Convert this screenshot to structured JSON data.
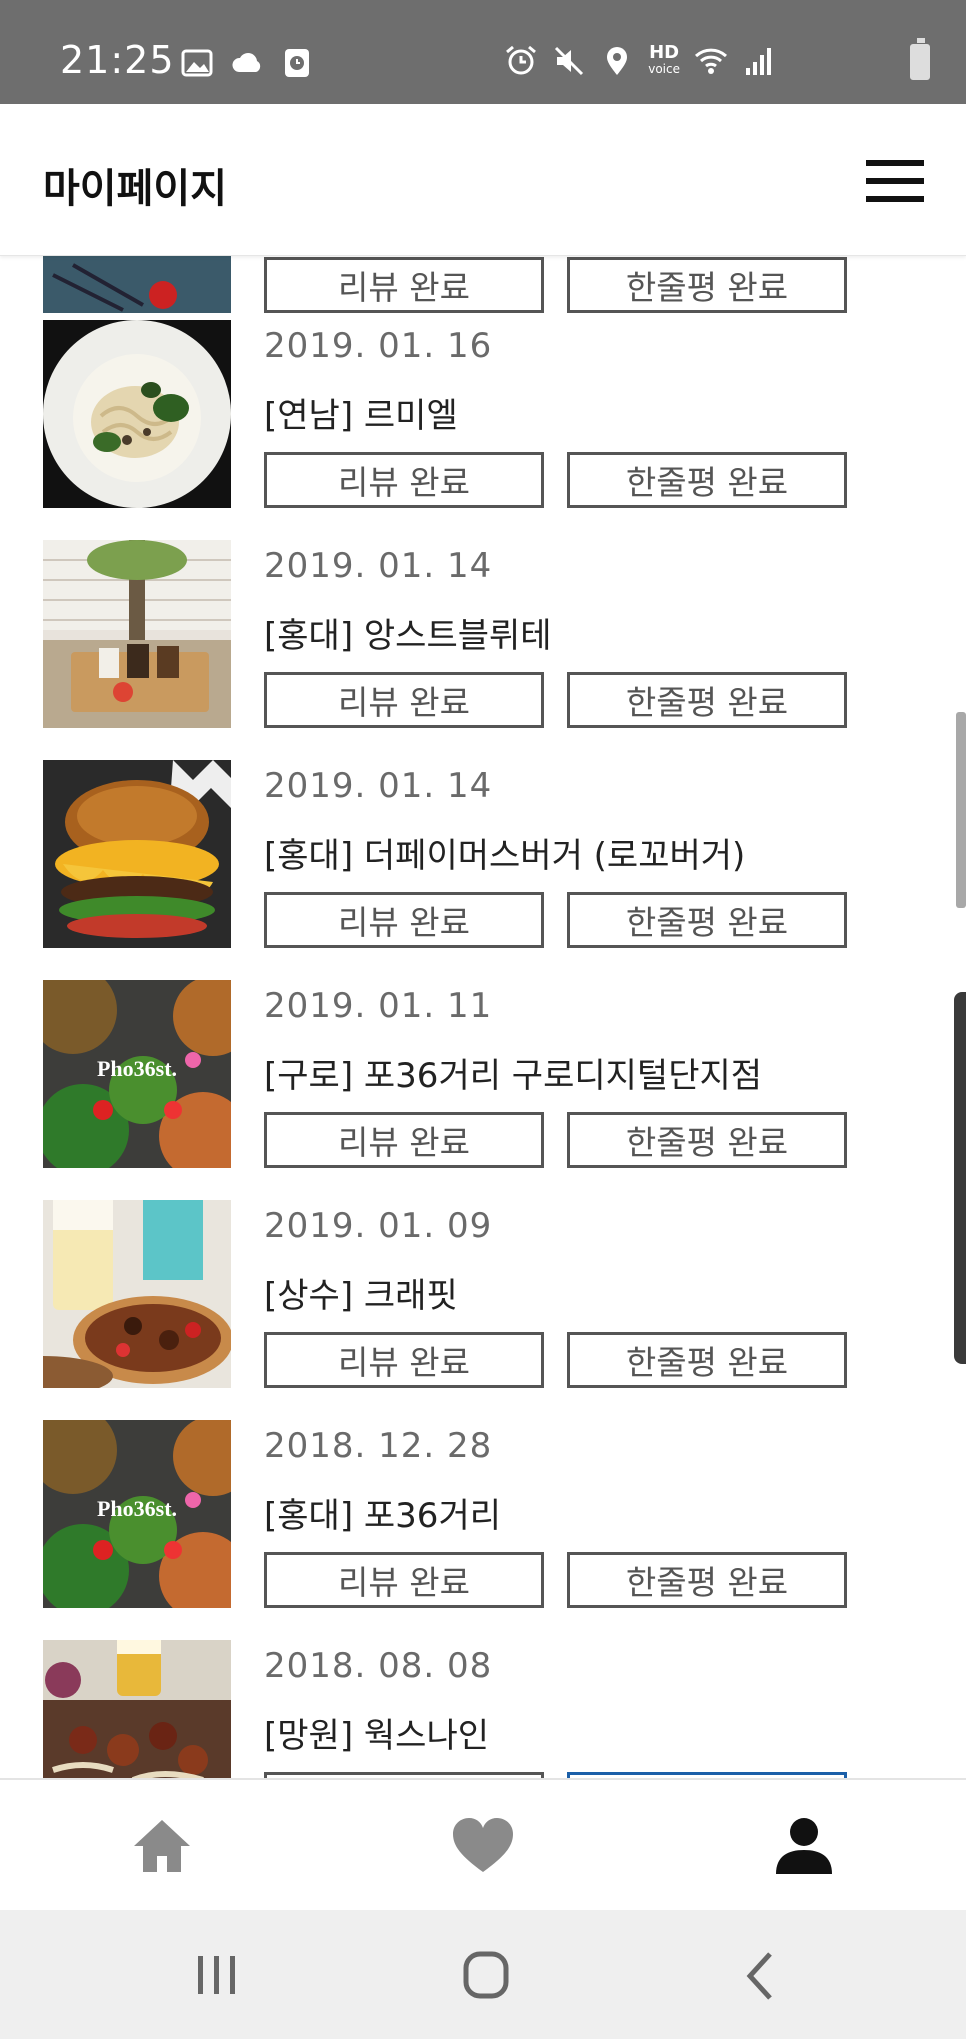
{
  "status_bar": {
    "time": "21:25",
    "hd_label": "HD",
    "voice_label": "voice",
    "left_icons": [
      "image-icon",
      "cloud-icon",
      "clock-app-icon"
    ],
    "right_icons": [
      "alarm-icon",
      "mute-icon",
      "location-icon",
      "hd-voice-icon",
      "wifi-icon",
      "signal-icon",
      "battery-icon"
    ]
  },
  "header": {
    "title": "마이페이지",
    "menu_icon": "hamburger-menu-icon"
  },
  "list": {
    "items": [
      {
        "date": "",
        "name": "",
        "review_label": "리뷰 완료",
        "oneline_label": "한줄평 완료",
        "thumb": "partial-food"
      },
      {
        "date": "2019. 01. 16",
        "name": "[연남] 르미엘",
        "review_label": "리뷰 완료",
        "oneline_label": "한줄평 완료",
        "thumb": "pasta-plate"
      },
      {
        "date": "2019. 01. 14",
        "name": "[홍대] 앙스트블뤼테",
        "review_label": "리뷰 완료",
        "oneline_label": "한줄평 완료",
        "thumb": "cafe-tray"
      },
      {
        "date": "2019. 01. 14",
        "name": "[홍대] 더페이머스버거 (로꼬버거)",
        "review_label": "리뷰 완료",
        "oneline_label": "한줄평 완료",
        "thumb": "burger"
      },
      {
        "date": "2019. 01. 11",
        "name": "[구로] 포36거리 구로디지털단지점",
        "review_label": "리뷰 완료",
        "oneline_label": "한줄평 완료",
        "thumb": "pho-bowls",
        "thumb_text": "Pho36st."
      },
      {
        "date": "2019. 01. 09",
        "name": "[상수] 크래핏",
        "review_label": "리뷰 완료",
        "oneline_label": "한줄평 완료",
        "thumb": "beer-pizza"
      },
      {
        "date": "2018. 12. 28",
        "name": "[홍대] 포36거리",
        "review_label": "리뷰 완료",
        "oneline_label": "한줄평 완료",
        "thumb": "pho-bowls",
        "thumb_text": "Pho36st."
      },
      {
        "date": "2018. 08. 08",
        "name": "[망원] 웍스나인",
        "review_label": "",
        "oneline_label": "",
        "thumb": "wok-dish"
      }
    ]
  },
  "bottom_nav": {
    "items": [
      {
        "icon": "home-icon",
        "active": false
      },
      {
        "icon": "heart-icon",
        "active": false
      },
      {
        "icon": "user-icon",
        "active": true
      }
    ]
  },
  "system_nav": {
    "buttons": [
      "recent-apps-icon",
      "home-circle-icon",
      "back-icon"
    ]
  },
  "colors": {
    "status_bar_bg": "#6e6e6e",
    "button_border": "#555555",
    "date_text": "#6a6a6a",
    "active_accent": "#1b5fa8"
  }
}
